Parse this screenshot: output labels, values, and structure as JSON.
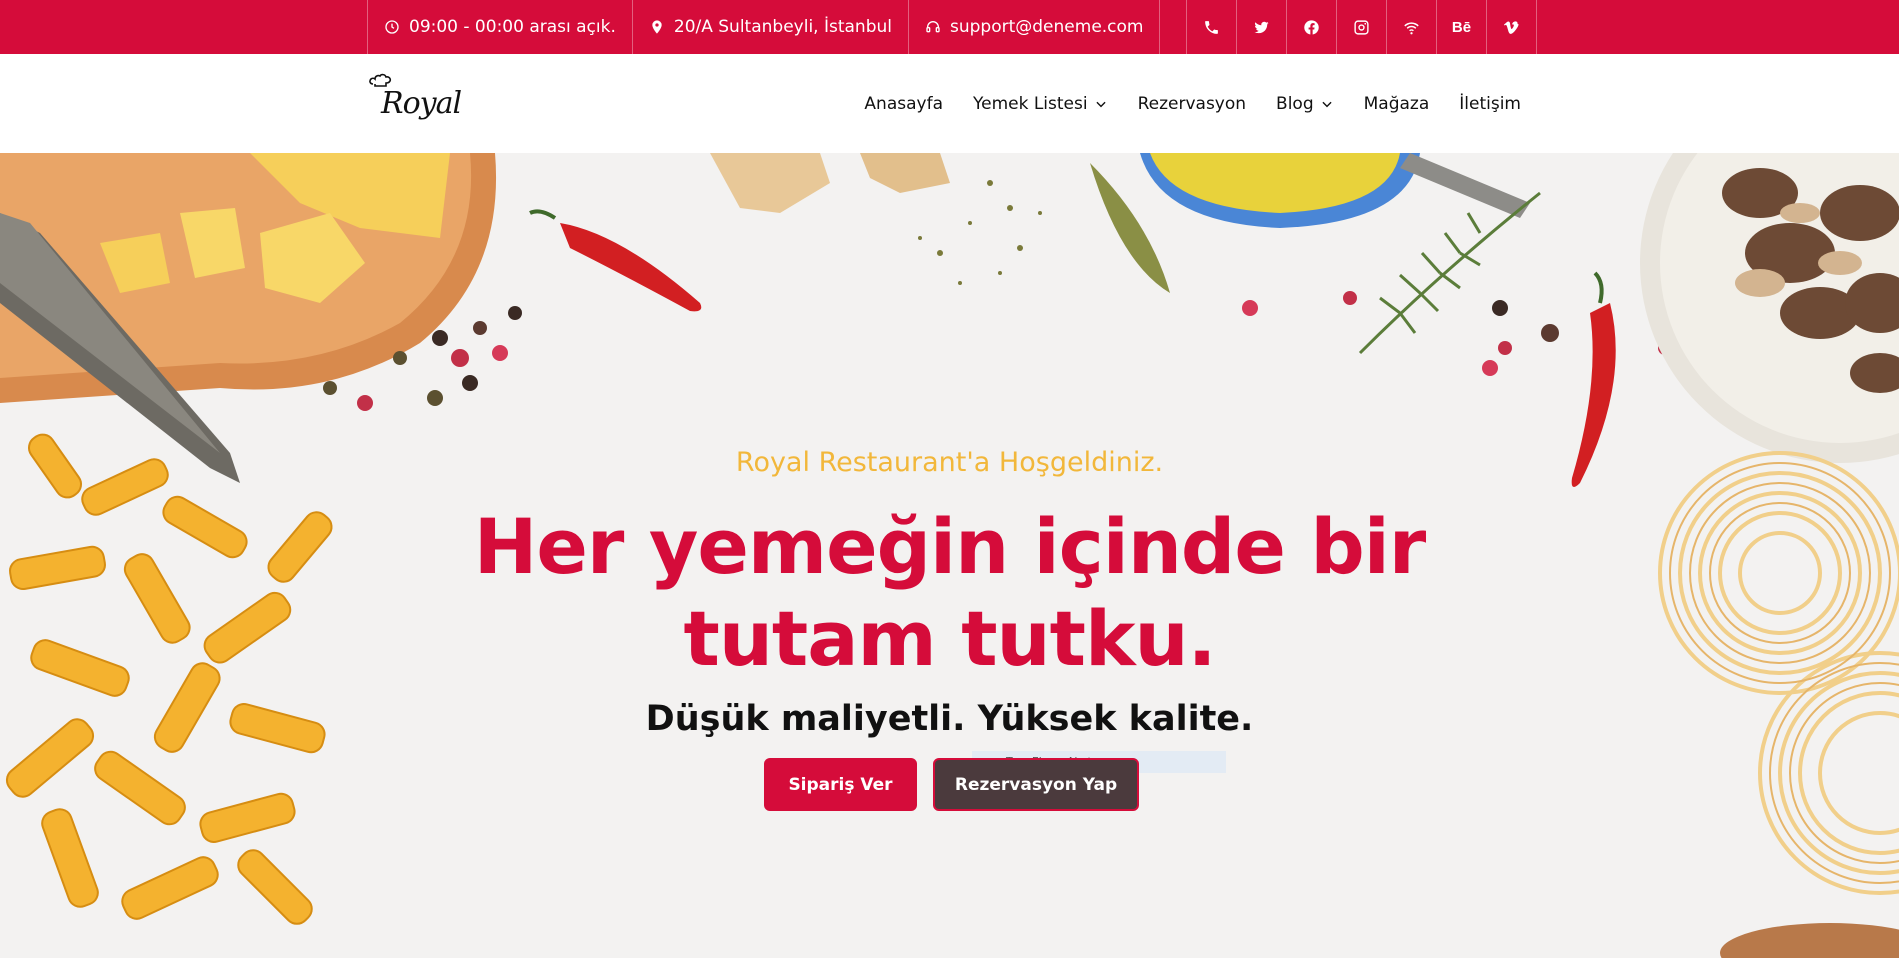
{
  "topbar": {
    "hours": "09:00 - 00:00 arası açık.",
    "address": "20/A Sultanbeyli, İstanbul",
    "email": "support@deneme.com",
    "social": [
      {
        "icon": "phone-icon"
      },
      {
        "icon": "twitter-icon"
      },
      {
        "icon": "facebook-icon"
      },
      {
        "icon": "instagram-icon"
      },
      {
        "icon": "wifi-icon"
      },
      {
        "icon": "behance-icon",
        "text": "Bē"
      },
      {
        "icon": "vimeo-icon"
      }
    ]
  },
  "header": {
    "logo_text": "Royal",
    "nav": [
      "Anasayfa",
      "Yemek Listesi",
      "Rezervasyon",
      "Blog",
      "Mağaza",
      "İletişim"
    ]
  },
  "hero": {
    "welcome": "Royal Restaurant'a Hoşgeldiniz.",
    "headline_line1": "Her yemeğin içinde bir",
    "headline_line2": "tutam tutku.",
    "subheadline": "Düşük maliyetli. Yüksek kalite.",
    "tooltip": "Tam Ekran Alıntısı",
    "button_order": "Sipariş Ver",
    "button_reserve": "Rezervasyon Yap"
  },
  "colors": {
    "brand_red": "#d50c3a",
    "accent_yellow": "#f2b73a",
    "dark_button": "#4b3a3d"
  }
}
